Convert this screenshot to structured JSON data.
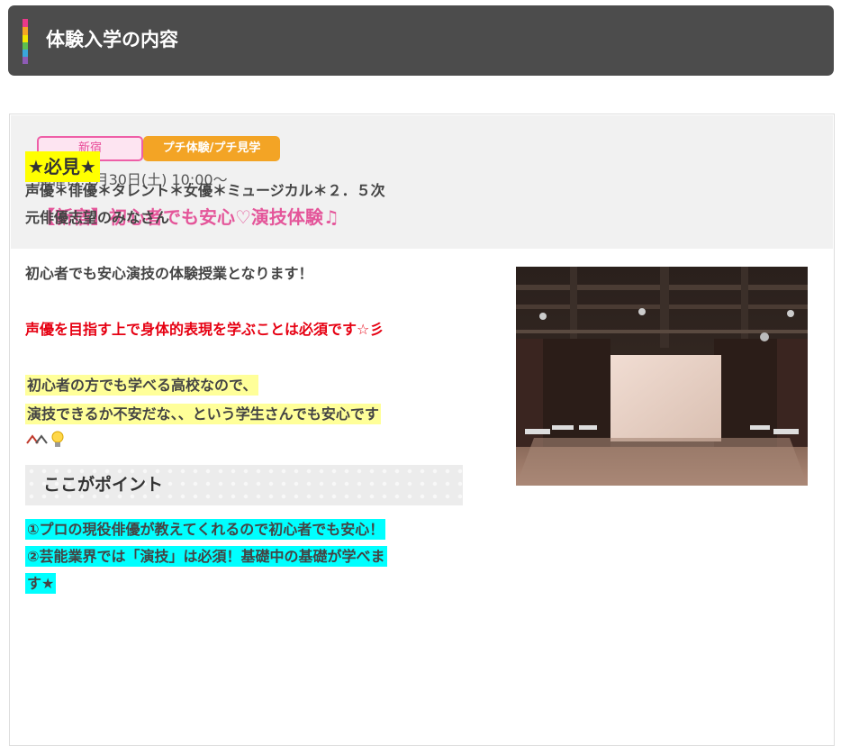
{
  "header": {
    "title": "体験入学の内容"
  },
  "event": {
    "tag_area": "新宿",
    "tag_type": "プチ体験/プチ見学",
    "date": "開催日:1月30日(土) 10:00～",
    "title": "【新宿】初心者でも安心♡演技体験♫"
  },
  "content": {
    "must_see": "★必見★",
    "target_line1": "声優＊俳優＊タレント＊女優＊ミュージカル＊２．５次",
    "target_line2": "元俳優志望のみなさん",
    "intro": "初心者でも安心演技の体験授業となります！",
    "red_text": "声優を目指す上で身体的表現を学ぶことは必須です☆彡",
    "yellow_line1": "初心者の方でも学べる高校なので、",
    "yellow_line2": "演技できるか不安だな、、という学生さんでも安心です",
    "point_heading": "ここがポイント",
    "point1": "①プロの現役俳優が教えてくれるので初心者でも安心！",
    "point2a": "②芸能業界では「演技」は必須！基礎中の基礎が学べま",
    "point2b": "す★"
  },
  "photo": {
    "icon": "studio-photo"
  },
  "colors": {
    "header_bg": "#4c4c4c",
    "accent_pink": "#e4569a",
    "tag_orange": "#f3a425",
    "highlight_yellow": "#ffff99",
    "highlight_cyan": "#00ffff",
    "alert_red": "#e60012"
  }
}
